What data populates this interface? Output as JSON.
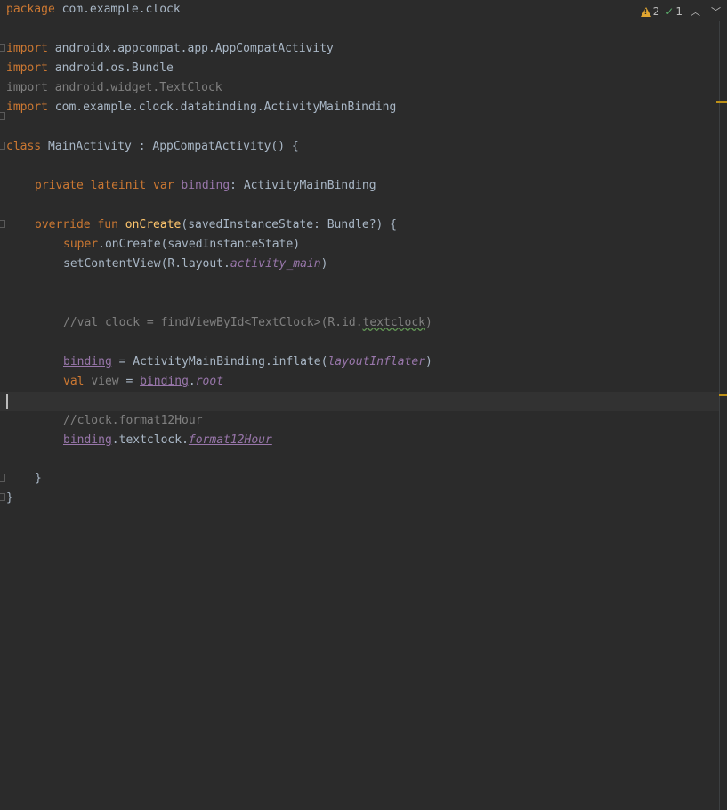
{
  "inspections": {
    "warnings_count": "2",
    "weak_warnings_count": "1",
    "prev_symbol": "^",
    "next_symbol": "v"
  },
  "code": {
    "l1_package_kw": "package",
    "l1_package_name": " com.example.clock",
    "l3_import_kw": "import",
    "l3_import": " androidx.appcompat.app.AppCompatActivity",
    "l4_import_kw": "import",
    "l4_import": " android.os.Bundle",
    "l5_import_kw": "import",
    "l5_import": " android.widget.TextClock",
    "l6_import_kw": "import",
    "l6_import": " com.example.clock.databinding.ActivityMainBinding",
    "l8_class_kw": "class",
    "l8_rest": " MainActivity : AppCompatActivity() {",
    "l10_mods": "private lateinit var",
    "l10_sp": " ",
    "l10_binding": "binding",
    "l10_rest": ": ActivityMainBinding",
    "l12_mods": "override fun",
    "l12_sp": " ",
    "l12_fn": "onCreate",
    "l12_rest": "(savedInstanceState: Bundle?) {",
    "l13_super": "super",
    "l13_rest": ".onCreate(savedInstanceState)",
    "l14_a": "setContentView(R.layout.",
    "l14_b": "activity_main",
    "l14_c": ")",
    "l17_a": "//val clock = findViewById<TextClock>(R.id.",
    "l17_b": "textclock",
    "l17_c": ")",
    "l19_binding": "binding",
    "l19_a": " = ActivityMainBinding.inflate(",
    "l19_b": "layoutInflater",
    "l19_c": ")",
    "l20_val": "val",
    "l20_sp": " ",
    "l20_view": "view",
    "l20_eq": " = ",
    "l20_binding": "binding",
    "l20_dot": ".",
    "l20_root": "root",
    "l22_comment": "//clock.format12Hour",
    "l23_binding": "binding",
    "l23_a": ".textclock.",
    "l23_b": "format12Hour",
    "l25_brace": "}",
    "l26_brace": "}"
  }
}
